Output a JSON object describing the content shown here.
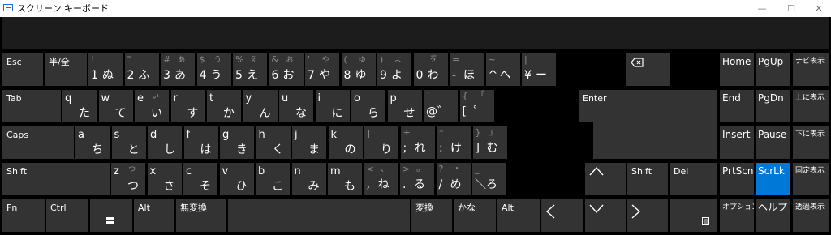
{
  "window": {
    "title": "スクリーン キーボード",
    "minimize": "—",
    "maximize": "☐",
    "close": "✕"
  },
  "row1": [
    {
      "label": "Esc"
    },
    {
      "label": "半/全"
    },
    {
      "sym": "!",
      "base": "1",
      "kana": "ぬ"
    },
    {
      "sym": "\"",
      "base": "2",
      "kana": "ふ"
    },
    {
      "sym": "#",
      "kshift": "ぁ",
      "base": "3",
      "kana": "あ"
    },
    {
      "sym": "$",
      "kshift": "ぅ",
      "base": "4",
      "kana": "う"
    },
    {
      "sym": "%",
      "kshift": "ぇ",
      "base": "5",
      "kana": "え"
    },
    {
      "sym": "&",
      "kshift": "ぉ",
      "base": "6",
      "kana": "お"
    },
    {
      "sym": "'",
      "kshift": "ゃ",
      "base": "7",
      "kana": "や"
    },
    {
      "sym": "(",
      "kshift": "ゅ",
      "base": "8",
      "kana": "ゆ"
    },
    {
      "sym": ")",
      "kshift": "ょ",
      "base": "9",
      "kana": "よ"
    },
    {
      "kshift": "を",
      "base": "0",
      "kana": "わ"
    },
    {
      "sym": "=",
      "base": "-",
      "kana": "ほ"
    },
    {
      "sym": "~",
      "base": "^",
      "kana": "へ"
    },
    {
      "sym": "|",
      "base": "¥",
      "kana": "ー"
    },
    {
      "icon": "backspace-icon"
    }
  ],
  "row2": [
    {
      "label": "Tab"
    },
    {
      "letter": "q",
      "kana": "た"
    },
    {
      "letter": "w",
      "kana": "て"
    },
    {
      "letter": "e",
      "kshift": "ぃ",
      "kana": "い"
    },
    {
      "letter": "r",
      "kana": "す"
    },
    {
      "letter": "t",
      "kana": "か"
    },
    {
      "letter": "y",
      "kana": "ん"
    },
    {
      "letter": "u",
      "kana": "な"
    },
    {
      "letter": "i",
      "kana": "に"
    },
    {
      "letter": "o",
      "kana": "ら"
    },
    {
      "letter": "p",
      "kana": "せ"
    },
    {
      "sym": "`",
      "base": "@",
      "kana": "゛"
    },
    {
      "sym": "{",
      "kshift": "「",
      "base": "[",
      "kana": "゜"
    },
    {
      "label": "Enter"
    }
  ],
  "row3": [
    {
      "label": "Caps"
    },
    {
      "letter": "a",
      "kana": "ち"
    },
    {
      "letter": "s",
      "kana": "と"
    },
    {
      "letter": "d",
      "kana": "し"
    },
    {
      "letter": "f",
      "kana": "は"
    },
    {
      "letter": "g",
      "kana": "き"
    },
    {
      "letter": "h",
      "kana": "く"
    },
    {
      "letter": "j",
      "kana": "ま"
    },
    {
      "letter": "k",
      "kana": "の"
    },
    {
      "letter": "l",
      "kana": "り"
    },
    {
      "sym": "+",
      "base": ";",
      "kana": "れ"
    },
    {
      "sym": "*",
      "base": ":",
      "kana": "け"
    },
    {
      "sym": "}",
      "kshift": "」",
      "base": "]",
      "kana": "む"
    }
  ],
  "row4": [
    {
      "label": "Shift"
    },
    {
      "letter": "z",
      "kshift": "っ",
      "kana": "つ"
    },
    {
      "letter": "x",
      "kana": "さ"
    },
    {
      "letter": "c",
      "kana": "そ"
    },
    {
      "letter": "v",
      "kana": "ひ"
    },
    {
      "letter": "b",
      "kana": "こ"
    },
    {
      "letter": "n",
      "kana": "み"
    },
    {
      "letter": "m",
      "kana": "も"
    },
    {
      "sym": "<",
      "kshift": "、",
      "base": ",",
      "kana": "ね"
    },
    {
      "sym": ">",
      "kshift": "。",
      "base": ".",
      "kana": "る"
    },
    {
      "sym": "?",
      "kshift": "・",
      "base": "/",
      "kana": "め"
    },
    {
      "sym": "_",
      "base": "＼",
      "kana": "ろ"
    },
    {
      "icon": "arrow-up-icon"
    },
    {
      "label": "Shift"
    },
    {
      "label": "Del"
    }
  ],
  "row5": [
    {
      "label": "Fn"
    },
    {
      "label": "Ctrl"
    },
    {
      "icon": "windows-icon"
    },
    {
      "label": "Alt"
    },
    {
      "label": "無変換"
    },
    {
      "label": ""
    },
    {
      "label": "変換"
    },
    {
      "label": "かな"
    },
    {
      "label": "Alt"
    },
    {
      "icon": "arrow-left-icon"
    },
    {
      "icon": "arrow-down-icon"
    },
    {
      "icon": "arrow-right-icon"
    },
    {
      "icon": "menu-icon"
    }
  ],
  "nav": [
    [
      "Home",
      "PgUp",
      "ナビ表示"
    ],
    [
      "End",
      "PgDn",
      "上に表示"
    ],
    [
      "Insert",
      "Pause",
      "下に表示"
    ],
    [
      "PrtScn",
      "ScrLk",
      "固定表示"
    ],
    [
      "オプション",
      "ヘルプ",
      "透過表示"
    ]
  ],
  "colors": {
    "key": "#333333",
    "active": "#0078d7",
    "background": "#000000",
    "top_area": "#1c1c1c",
    "dim_text": "#8a8a8a"
  }
}
